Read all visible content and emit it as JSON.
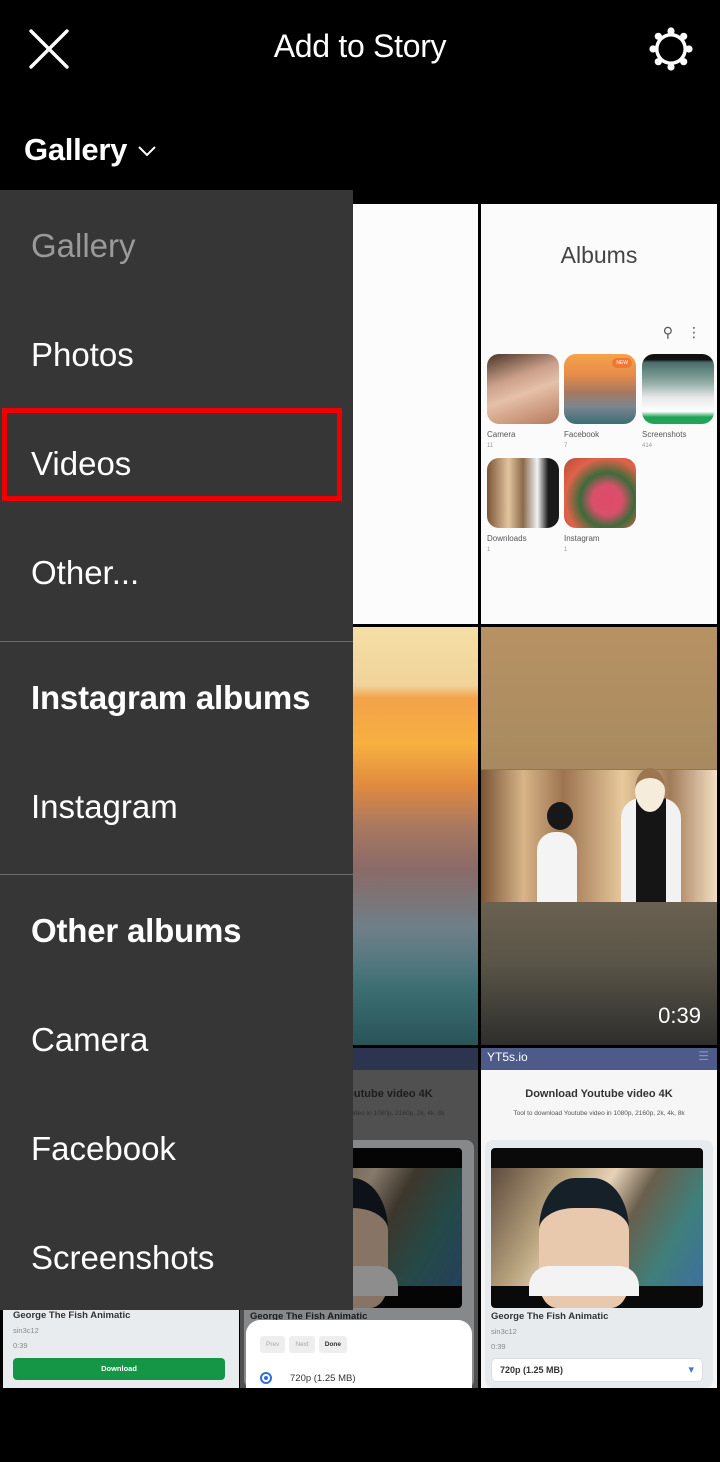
{
  "header": {
    "title": "Add to Story",
    "close_icon": "close-icon",
    "settings_icon": "settings-gear-icon"
  },
  "source_selector": {
    "label": "Gallery",
    "icon": "chevron-down-icon"
  },
  "menu": {
    "items": [
      {
        "label": "Gallery",
        "type": "item",
        "state": "current"
      },
      {
        "label": "Photos",
        "type": "item"
      },
      {
        "label": "Videos",
        "type": "item",
        "highlighted": true
      },
      {
        "label": "Other...",
        "type": "item"
      },
      {
        "label": "Instagram albums",
        "type": "header"
      },
      {
        "label": "Instagram",
        "type": "item"
      },
      {
        "label": "Other albums",
        "type": "header"
      },
      {
        "label": "Camera",
        "type": "item"
      },
      {
        "label": "Facebook",
        "type": "item"
      },
      {
        "label": "Screenshots",
        "type": "item"
      }
    ],
    "highlight_color": "#ee0000"
  },
  "grid": {
    "albums_tile": {
      "title": "Albums",
      "albums": [
        {
          "name": "Camera",
          "count": "11"
        },
        {
          "name": "Facebook",
          "count": "7",
          "badge": "NEW"
        },
        {
          "name": "Screenshots",
          "count": "414"
        },
        {
          "name": "Downloads",
          "count": "1"
        },
        {
          "name": "Instagram",
          "count": "1"
        }
      ]
    },
    "video_tile": {
      "duration": "0:39"
    },
    "yt_tiles": {
      "site": "YT5s.io",
      "heading": "Download Youtube video 4K",
      "subheading": "Tool to download Youtube video in 1080p, 2160p, 2k, 4k, 8k",
      "video_title": "George The Fish Animatic",
      "author": "sin3c12",
      "time": "0:39",
      "quality": "720p (1.25 MB)",
      "download_label": "Download",
      "sheet_buttons": [
        "Prev",
        "Next",
        "Done"
      ]
    }
  },
  "colors": {
    "background": "#000000",
    "menu_background": "#363636",
    "download_green": "#159647",
    "yt_header": "#4d5a8a"
  }
}
